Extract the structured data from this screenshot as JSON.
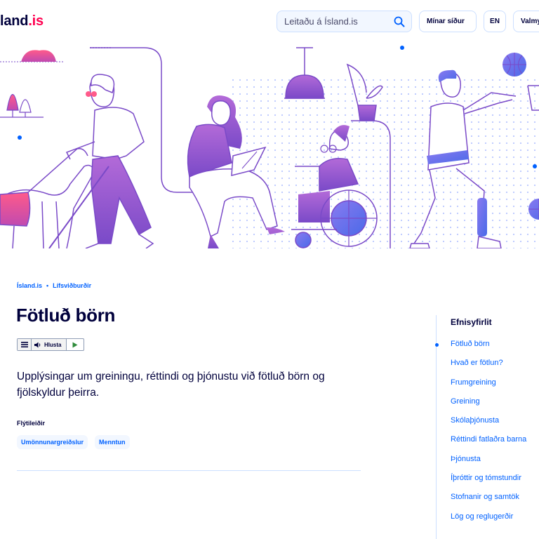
{
  "header": {
    "logo_text": "land",
    "logo_suffix": ".is",
    "search_placeholder": "Leitaðu á Ísland.is",
    "my_pages_label": "Mínar síður",
    "language_label": "EN",
    "menu_label": "Valmynd"
  },
  "breadcrumb": {
    "items": [
      "Ísland.is",
      "Lífsviðburðir"
    ],
    "separator": "•"
  },
  "page": {
    "title": "Fötluð börn",
    "intro": "Upplýsingar um greiningu, réttindi og þjónustu við fötluð börn og fjölskyldur þeirra.",
    "readspeaker_label": "Hlusta",
    "quick_links_label": "Flýtileiðir",
    "quick_links": [
      "Umönnunargreiðslur",
      "Menntun"
    ]
  },
  "toc": {
    "title": "Efnisyfirlit",
    "items": [
      "Fötluð börn",
      "Hvað er fötlun?",
      "Frumgreining",
      "Greining",
      "Skólaþjónusta",
      "Réttindi fatlaðra barna",
      "Þjónusta",
      "Íþróttir og tómstundir",
      "Stofnanir og samtök",
      "Lög og reglugerðir"
    ],
    "active_index": 0
  },
  "colors": {
    "primary_blue": "#0061ff",
    "dark_navy": "#00003c",
    "light_blue_bg": "#f2f7ff",
    "border_blue": "#ccdfff",
    "illustration_purple": "#9a5cc4",
    "illustration_pink": "#e04a8a",
    "illustration_blue": "#6a6ae8"
  }
}
